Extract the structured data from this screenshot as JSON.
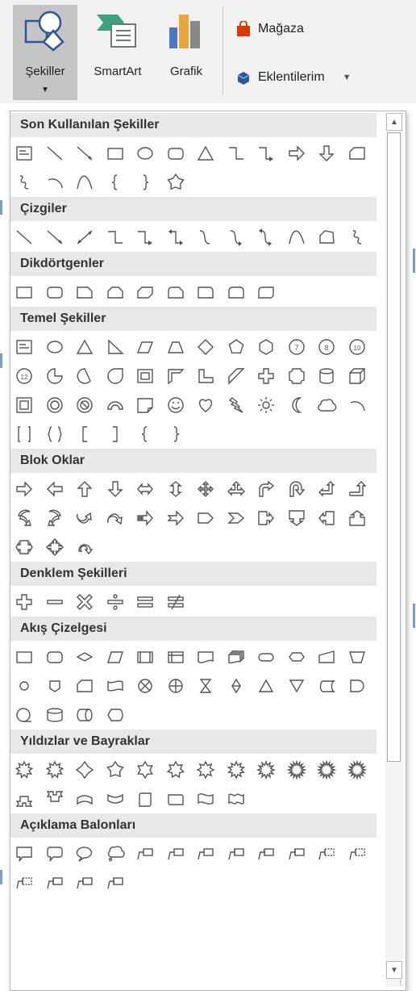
{
  "ribbon": {
    "shapes": {
      "label": "Şekiller",
      "caret": "▼"
    },
    "smartart": {
      "label": "SmartArt"
    },
    "chart": {
      "label": "Grafik"
    },
    "store": {
      "label": "Mağaza"
    },
    "addins": {
      "label": "Eklentilerim",
      "caret": "▼"
    }
  },
  "colors": {
    "accent": "#2b579a",
    "store_red": "#d83b01",
    "selected_bg": "#c5c5c5",
    "section_bg": "#e8e8e8",
    "stroke": "#555555"
  },
  "sections": [
    {
      "title": "Son Kullanılan Şekiller",
      "rows": [
        [
          "text-box",
          "line",
          "arrow-line",
          "rectangle",
          "oval",
          "rounded-rectangle",
          "triangle",
          "elbow-connector",
          "elbow-arrow-connector",
          "right-arrow",
          "down-arrow",
          "flowchart-card"
        ],
        [
          "freeform-scribble",
          "arc",
          "curve",
          "left-brace",
          "right-brace",
          "star-5"
        ]
      ]
    },
    {
      "title": "Çizgiler",
      "rows": [
        [
          "line",
          "arrow-line",
          "double-arrow-line",
          "elbow-connector",
          "elbow-arrow-connector",
          "elbow-double-arrow",
          "curved-connector",
          "curved-arrow-connector",
          "curved-double-arrow",
          "curve",
          "freeform-shape",
          "freeform-scribble"
        ]
      ]
    },
    {
      "title": "Dikdörtgenler",
      "rows": [
        [
          "rectangle",
          "rounded-rectangle",
          "snip-single-corner",
          "snip-same-side",
          "snip-diagonal",
          "snip-round-single",
          "round-single-corner",
          "round-same-side",
          "round-diagonal"
        ]
      ]
    },
    {
      "title": "Temel Şekiller",
      "rows": [
        [
          "text-box",
          "oval",
          "isosceles-triangle",
          "right-triangle",
          "parallelogram",
          "trapezoid",
          "diamond",
          "pentagon",
          "hexagon",
          "heptagon",
          "octagon",
          "decagon"
        ],
        [
          "dodecagon",
          "pie",
          "chord",
          "teardrop",
          "frame",
          "half-frame",
          "l-shape",
          "diagonal-stripe",
          "cross",
          "plaque",
          "can",
          "cube"
        ],
        [
          "bevel",
          "donut",
          "no-symbol",
          "block-arc",
          "folded-corner",
          "smiley",
          "heart",
          "lightning",
          "sun",
          "moon",
          "cloud",
          "arc"
        ],
        [
          "double-bracket",
          "double-brace",
          "left-bracket",
          "right-bracket",
          "left-brace",
          "right-brace"
        ]
      ]
    },
    {
      "title": "Blok Oklar",
      "rows": [
        [
          "right-arrow",
          "left-arrow",
          "up-arrow",
          "down-arrow",
          "left-right-arrow",
          "up-down-arrow",
          "quad-arrow",
          "left-right-up-arrow",
          "bent-arrow",
          "u-turn-arrow",
          "left-up-arrow",
          "bent-up-arrow"
        ],
        [
          "curved-right-arrow",
          "curved-left-arrow",
          "curved-up-arrow",
          "curved-down-arrow",
          "striped-right-arrow",
          "notched-right-arrow",
          "pentagon-arrow",
          "chevron",
          "right-arrow-callout",
          "down-arrow-callout",
          "left-arrow-callout",
          "up-arrow-callout"
        ],
        [
          "left-right-arrow-callout",
          "quad-arrow-callout",
          "circular-arrow"
        ]
      ]
    },
    {
      "title": "Denklem Şekilleri",
      "rows": [
        [
          "plus",
          "minus",
          "multiply",
          "division",
          "equal",
          "not-equal"
        ]
      ]
    },
    {
      "title": "Akış Çizelgesi",
      "rows": [
        [
          "process",
          "alternate-process",
          "decision",
          "data",
          "predefined-process",
          "internal-storage",
          "document",
          "multidocument",
          "terminator",
          "preparation",
          "manual-input",
          "manual-operation"
        ],
        [
          "connector",
          "off-page-connector",
          "card",
          "punched-tape",
          "summing-junction",
          "or",
          "collate",
          "sort",
          "extract",
          "merge",
          "stored-data",
          "delay"
        ],
        [
          "sequential-access",
          "magnetic-disk",
          "direct-access",
          "display"
        ]
      ]
    },
    {
      "title": "Yıldızlar ve Bayraklar",
      "rows": [
        [
          "explosion-1",
          "explosion-2",
          "star-4",
          "star-5",
          "star-6",
          "star-7",
          "star-8",
          "star-10",
          "star-12",
          "star-16",
          "star-24",
          "star-32"
        ],
        [
          "ribbon-up",
          "ribbon-down",
          "curved-ribbon-up",
          "curved-ribbon-down",
          "vertical-scroll",
          "horizontal-scroll",
          "wave",
          "double-wave"
        ]
      ]
    },
    {
      "title": "Açıklama Balonları",
      "rows": [
        [
          "rectangular-callout",
          "rounded-callout",
          "oval-callout",
          "cloud-callout",
          "line-callout-1",
          "line-callout-2",
          "line-callout-3",
          "line-callout-1-accent",
          "line-callout-2-accent",
          "line-callout-3-accent",
          "line-callout-1-noborder",
          "line-callout-2-noborder"
        ],
        [
          "line-callout-3-noborder",
          "line-callout-1-border",
          "line-callout-2-border",
          "line-callout-3-border"
        ]
      ]
    }
  ],
  "scrollbar": {
    "up": "▲",
    "down": "▼",
    "grip": "⁞"
  }
}
